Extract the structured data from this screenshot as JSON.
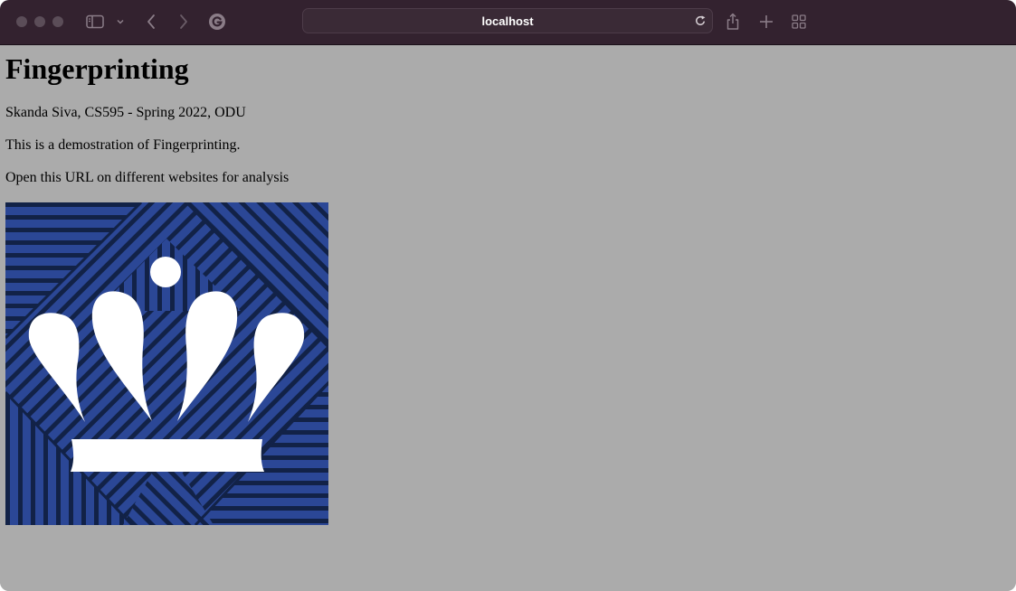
{
  "browser": {
    "url": "localhost"
  },
  "page": {
    "title": "Fingerprinting",
    "byline": "Skanda Siva, CS595 - Spring 2022, ODU",
    "description": "This is a demostration of Fingerprinting.",
    "instruction": "Open this URL on different websites for analysis"
  },
  "colors": {
    "toolbar_bg": "#33222f",
    "page_bg": "#ababab",
    "logo_blue": "#2b4796",
    "logo_navy": "#122247"
  },
  "icons": {
    "sidebar": "sidebar-icon",
    "chevron": "chevron-down-icon",
    "back": "back-icon",
    "forward": "forward-icon",
    "extension": "grammarly-icon",
    "reload": "reload-icon",
    "share": "share-icon",
    "new_tab": "plus-icon",
    "tabs": "tab-overview-icon"
  }
}
